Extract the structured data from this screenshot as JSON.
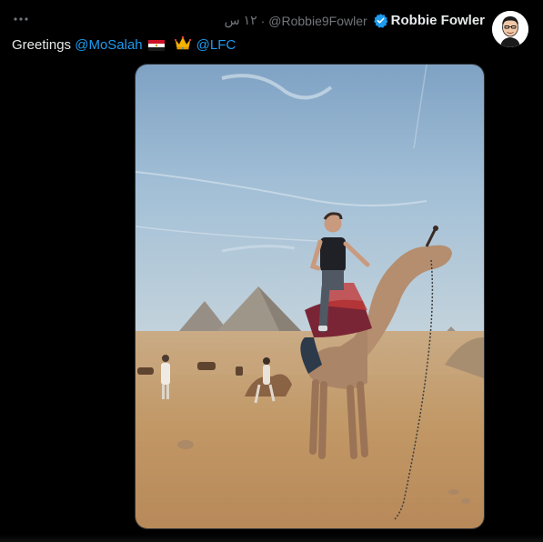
{
  "author": {
    "name": "Robbie Fowler",
    "handle": "@Robbie9Fowler",
    "separator": "·",
    "time": "١٢ س",
    "verified": true
  },
  "tweet": {
    "greeting": "Greetings",
    "mention_1": "@MoSalah",
    "mention_2": "@LFC",
    "emojis": [
      "egypt-flag",
      "crown"
    ]
  },
  "colors": {
    "background": "#000000",
    "text": "#e7e9ea",
    "muted": "#71767b",
    "link": "#1d9bf0"
  },
  "icons": {
    "more": "more-icon",
    "verified": "verified-badge-icon"
  }
}
